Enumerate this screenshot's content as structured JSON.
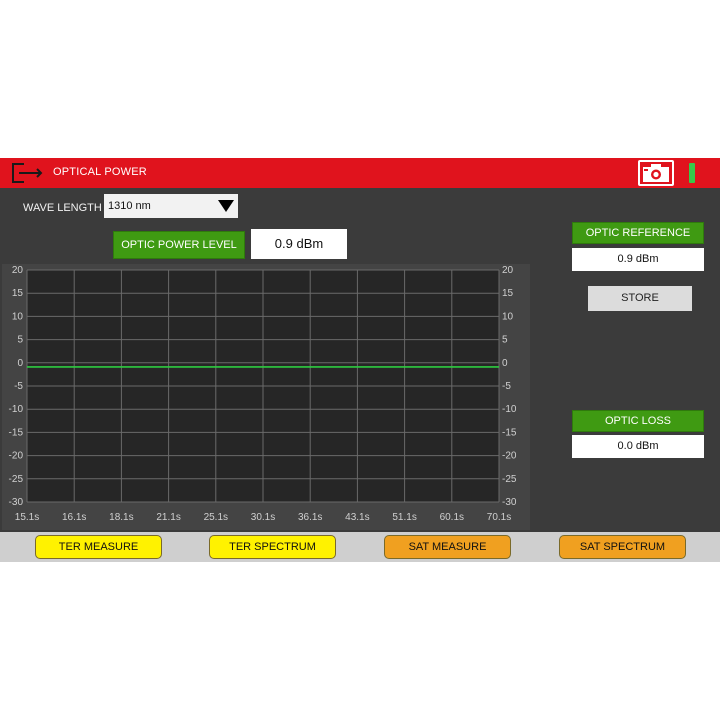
{
  "header": {
    "title": "OPTICAL POWER",
    "exit_icon": "exit-icon",
    "camera_icon": "camera-icon",
    "battery_icon": "battery-icon",
    "header_color": "#e0131d",
    "battery_color": "#37c94a"
  },
  "wavelength": {
    "label": "WAVE LENGTH",
    "selected": "1310 nm"
  },
  "optic_power": {
    "label": "OPTIC POWER LEVEL",
    "value": "0.9 dBm"
  },
  "reference": {
    "label": "OPTIC REFERENCE",
    "value": "0.9 dBm",
    "store_label": "STORE"
  },
  "loss": {
    "label": "OPTIC LOSS",
    "value": "0.0 dBm"
  },
  "chart_data": {
    "type": "line",
    "x_tick_labels": [
      "15.1s",
      "16.1s",
      "18.1s",
      "21.1s",
      "25.1s",
      "30.1s",
      "36.1s",
      "43.1s",
      "51.1s",
      "60.1s",
      "70.1s"
    ],
    "y_tick_labels": [
      "20",
      "15",
      "10",
      "5",
      "0",
      "-5",
      "-10",
      "-15",
      "-20",
      "-25",
      "-30"
    ],
    "ylim": [
      -30,
      20
    ],
    "grid": true,
    "series": [
      {
        "values": [
          -0.9,
          -0.9,
          -0.9,
          -0.9,
          -0.9,
          -0.9,
          -0.9,
          -0.9,
          -0.9,
          -0.9,
          -0.9
        ],
        "color": "#2ecc40"
      }
    ]
  },
  "bottom_nav": [
    {
      "label": "TER MEASURE",
      "color": "#fff200"
    },
    {
      "label": "TER SPECTRUM",
      "color": "#fff200"
    },
    {
      "label": "SAT MEASURE",
      "color": "#f0a020"
    },
    {
      "label": "SAT SPECTRUM",
      "color": "#f0a020"
    }
  ]
}
